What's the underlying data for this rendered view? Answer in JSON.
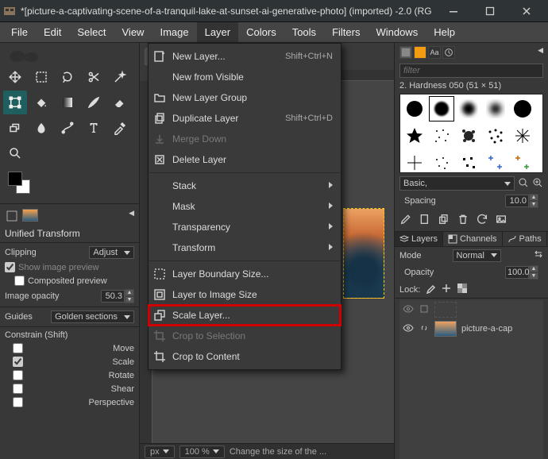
{
  "window": {
    "title": "*[picture-a-captivating-scene-of-a-tranquil-lake-at-sunset-ai-generative-photo] (imported) -2.0 (RG"
  },
  "menubar": [
    "File",
    "Edit",
    "Select",
    "View",
    "Image",
    "Layer",
    "Colors",
    "Tools",
    "Filters",
    "Windows",
    "Help"
  ],
  "layer_menu": {
    "new_layer": "New Layer...",
    "new_layer_accel": "Shift+Ctrl+N",
    "new_from_visible": "New from Visible",
    "new_layer_group": "New Layer Group",
    "duplicate_layer": "Duplicate Layer",
    "duplicate_layer_accel": "Shift+Ctrl+D",
    "merge_down": "Merge Down",
    "delete_layer": "Delete Layer",
    "stack": "Stack",
    "mask": "Mask",
    "transparency": "Transparency",
    "transform": "Transform",
    "layer_boundary_size": "Layer Boundary Size...",
    "layer_to_image_size": "Layer to Image Size",
    "scale_layer": "Scale Layer...",
    "crop_to_selection": "Crop to Selection",
    "crop_to_content": "Crop to Content"
  },
  "tool_options": {
    "title": "Unified Transform",
    "clipping_label": "Clipping",
    "clipping_value": "Adjust",
    "show_image_preview": "Show image preview",
    "composited_preview": "Composited preview",
    "image_opacity_label": "Image opacity",
    "image_opacity_value": "50.3",
    "guides_label": "Guides",
    "guides_value": "Golden sections",
    "constrain_label": "Constrain (Shift)",
    "constrain": {
      "move": "Move",
      "scale": "Scale",
      "rotate": "Rotate",
      "shear": "Shear",
      "perspective": "Perspective"
    }
  },
  "brushes": {
    "filter_placeholder": "filter",
    "selected_label": "2. Hardness 050 (51 × 51)",
    "preset_label": "Basic,",
    "spacing_label": "Spacing",
    "spacing_value": "10.0"
  },
  "layers": {
    "tabs": {
      "layers": "Layers",
      "channels": "Channels",
      "paths": "Paths"
    },
    "mode_label": "Mode",
    "mode_value": "Normal",
    "opacity_label": "Opacity",
    "opacity_value": "100.0",
    "lock_label": "Lock:",
    "layer_name": "picture-a-cap"
  },
  "status": {
    "unit": "px",
    "zoom": "100 %",
    "message": "Change the size of the ..."
  }
}
